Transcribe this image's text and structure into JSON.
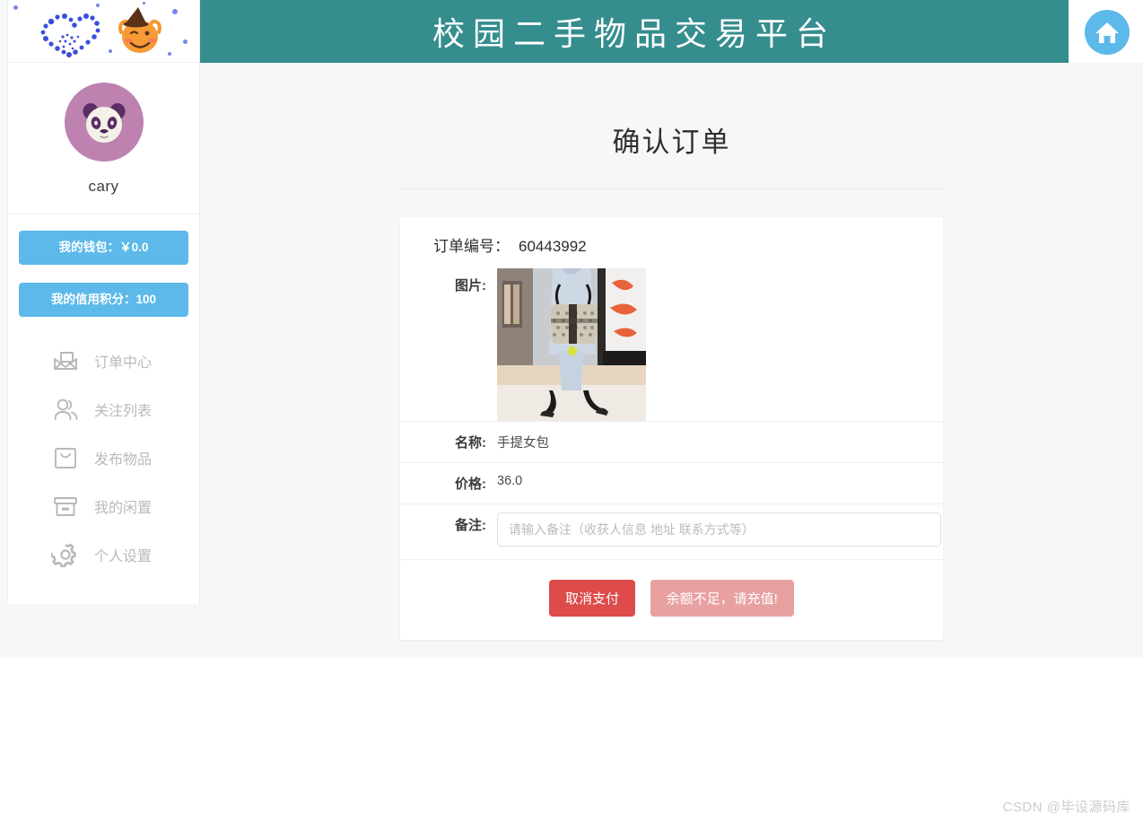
{
  "header": {
    "site_title": "校园二手物品交易平台",
    "home_icon": "home-icon",
    "teal_color": "#358d8e",
    "accent_blue": "#5cb9e9"
  },
  "sidebar": {
    "banner": {
      "heart_icon": "dotted-heart-decoration",
      "pumpkin_icon": "halloween-pumpkin-decoration"
    },
    "profile": {
      "avatar_icon": "panda-avatar",
      "username": "cary"
    },
    "pills": [
      {
        "label": "我的钱包：￥0.0",
        "name": "wallet-pill"
      },
      {
        "label": "我的信用积分：100",
        "name": "credit-score-pill"
      }
    ],
    "nav_items": [
      {
        "label": "订单中心",
        "icon": "envelope-icon"
      },
      {
        "label": "关注列表",
        "icon": "users-icon"
      },
      {
        "label": "发布物品",
        "icon": "shopping-bag-icon"
      },
      {
        "label": "我的闲置",
        "icon": "archive-box-icon"
      },
      {
        "label": "个人设置",
        "icon": "gear-icon"
      }
    ]
  },
  "main": {
    "page_title": "确认订单",
    "order": {
      "order_no_label": "订单编号：",
      "order_no_value": "60443992",
      "image_label": "图片:",
      "image_alt": "手提女包商品图片",
      "name_label": "名称:",
      "name_value": "手提女包",
      "price_label": "价格:",
      "price_value": "36.0",
      "note_label": "备注:",
      "note_value": "",
      "note_placeholder": "请输入备注（收获人信息 地址 联系方式等）"
    },
    "buttons": {
      "cancel": "取消支付",
      "insufficient": "余额不足，请充值!",
      "cancel_color": "#dd4b4b",
      "insufficient_color": "#e8a0a0"
    }
  },
  "watermark": "CSDN @毕设源码库"
}
